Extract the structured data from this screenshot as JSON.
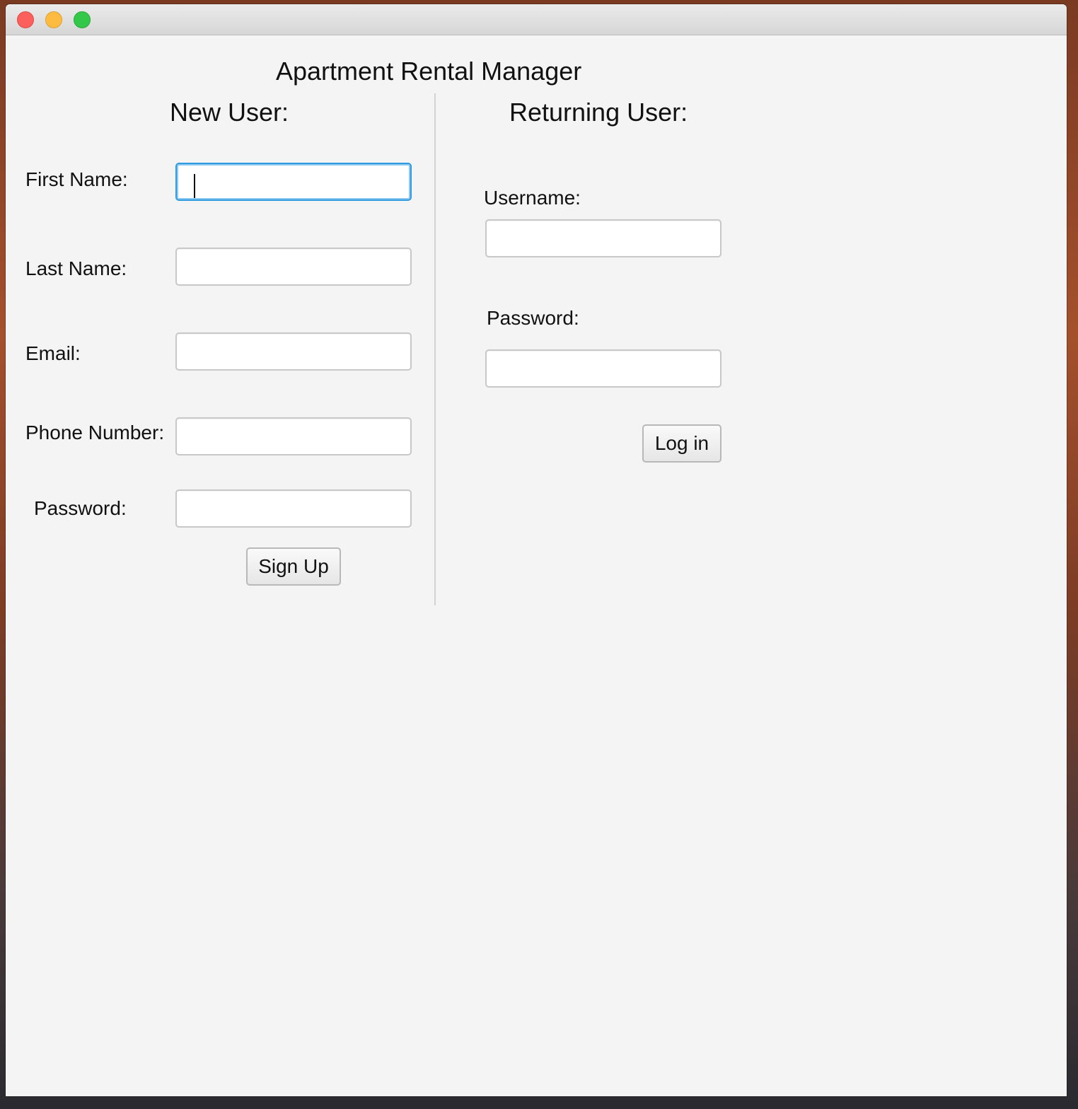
{
  "window": {
    "title": "",
    "controls": [
      "close",
      "minimize",
      "maximize"
    ]
  },
  "app": {
    "title": "Apartment Rental Manager"
  },
  "new_user": {
    "heading": "New User:",
    "first_name_label": "First Name:",
    "first_name_value": "",
    "last_name_label": "Last Name:",
    "last_name_value": "",
    "email_label": "Email:",
    "email_value": "",
    "phone_label": "Phone Number:",
    "phone_value": "",
    "password_label": "Password:",
    "password_value": "",
    "signup_label": "Sign Up"
  },
  "returning_user": {
    "heading": "Returning User:",
    "username_label": "Username:",
    "username_value": "",
    "password_label": "Password:",
    "password_value": "",
    "login_label": "Log in"
  },
  "colors": {
    "focus_ring": "#2f9ae0",
    "close": "#fc605c",
    "minimize": "#fdbc40",
    "maximize": "#34c84a"
  }
}
